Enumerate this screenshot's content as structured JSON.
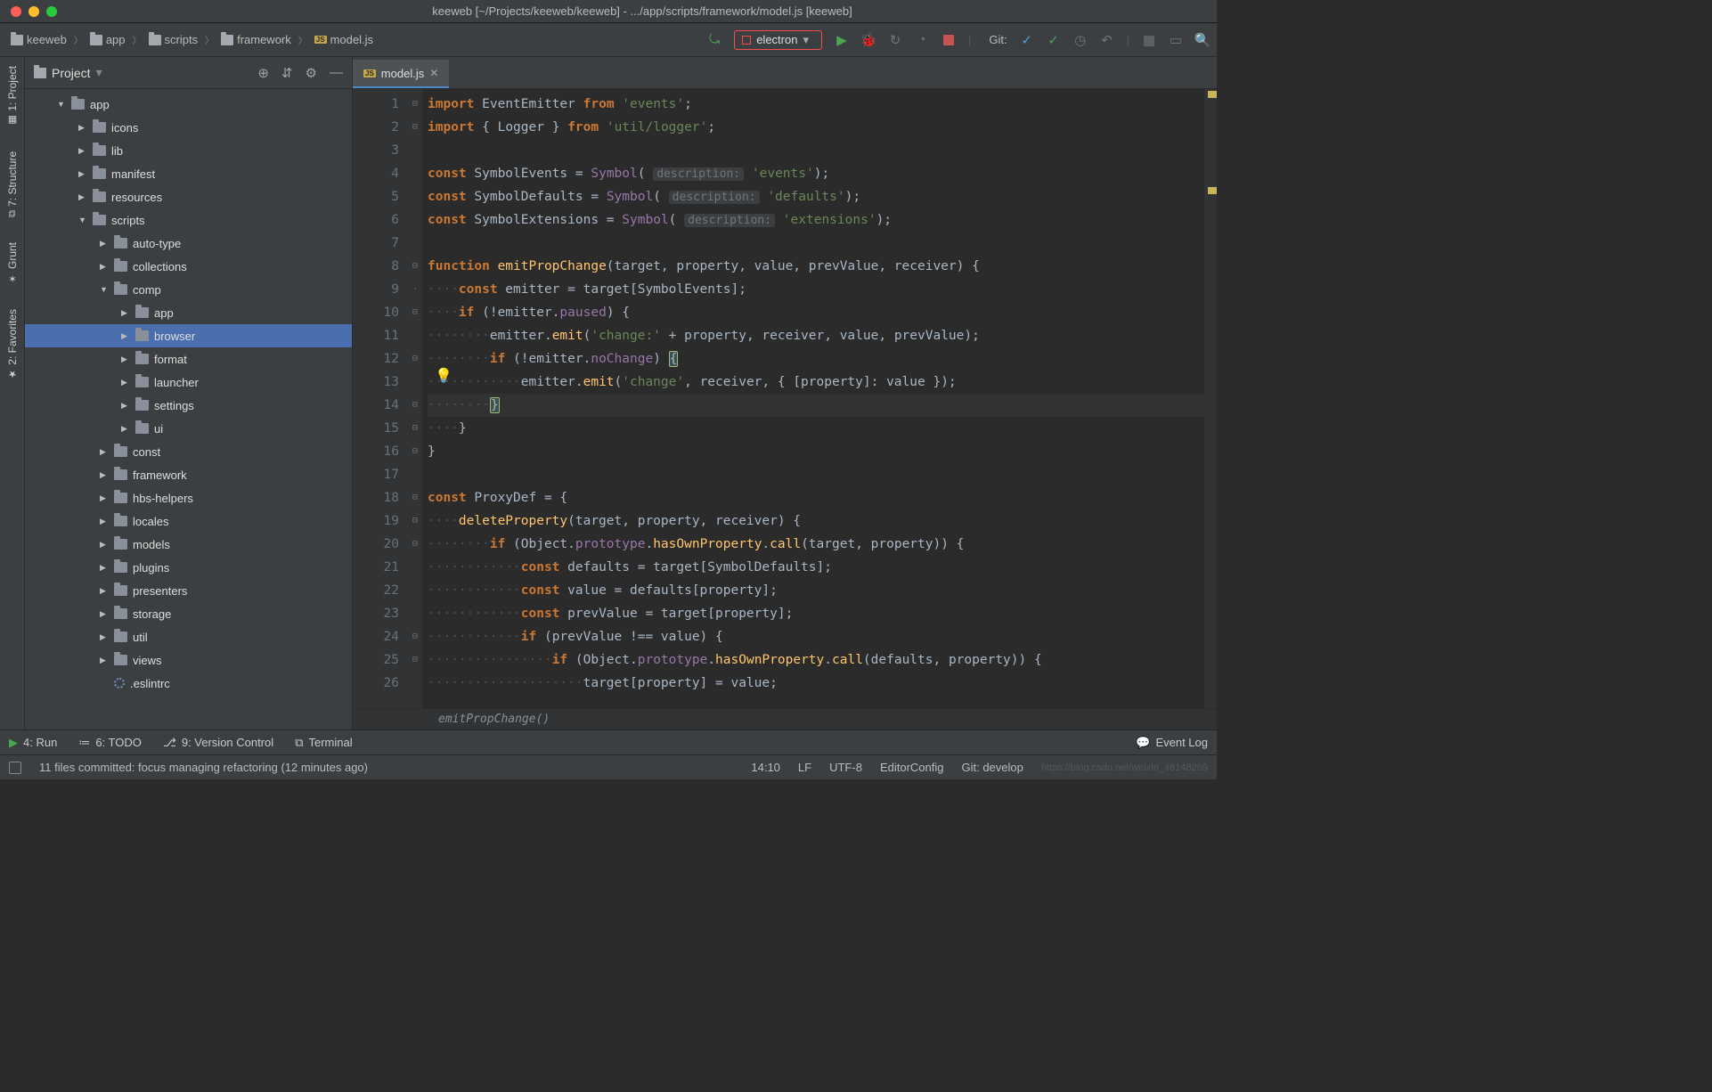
{
  "window": {
    "title": "keeweb [~/Projects/keeweb/keeweb] - .../app/scripts/framework/model.js [keeweb]"
  },
  "breadcrumb": [
    "keeweb",
    "app",
    "scripts",
    "framework",
    "model.js"
  ],
  "run_config": "electron",
  "git_label": "Git:",
  "left_tabs": [
    "1: Project",
    "7: Structure",
    "Grunt",
    "2: Favorites"
  ],
  "tree_header": "Project",
  "tree": [
    {
      "name": "app",
      "depth": 1,
      "caret": "down"
    },
    {
      "name": "icons",
      "depth": 2,
      "caret": "right"
    },
    {
      "name": "lib",
      "depth": 2,
      "caret": "right"
    },
    {
      "name": "manifest",
      "depth": 2,
      "caret": "right"
    },
    {
      "name": "resources",
      "depth": 2,
      "caret": "right"
    },
    {
      "name": "scripts",
      "depth": 2,
      "caret": "down"
    },
    {
      "name": "auto-type",
      "depth": 3,
      "caret": "right"
    },
    {
      "name": "collections",
      "depth": 3,
      "caret": "right"
    },
    {
      "name": "comp",
      "depth": 3,
      "caret": "down"
    },
    {
      "name": "app",
      "depth": 4,
      "caret": "right"
    },
    {
      "name": "browser",
      "depth": 4,
      "caret": "right",
      "sel": true
    },
    {
      "name": "format",
      "depth": 4,
      "caret": "right"
    },
    {
      "name": "launcher",
      "depth": 4,
      "caret": "right"
    },
    {
      "name": "settings",
      "depth": 4,
      "caret": "right"
    },
    {
      "name": "ui",
      "depth": 4,
      "caret": "right"
    },
    {
      "name": "const",
      "depth": 3,
      "caret": "right"
    },
    {
      "name": "framework",
      "depth": 3,
      "caret": "right"
    },
    {
      "name": "hbs-helpers",
      "depth": 3,
      "caret": "right"
    },
    {
      "name": "locales",
      "depth": 3,
      "caret": "right"
    },
    {
      "name": "models",
      "depth": 3,
      "caret": "right"
    },
    {
      "name": "plugins",
      "depth": 3,
      "caret": "right"
    },
    {
      "name": "presenters",
      "depth": 3,
      "caret": "right"
    },
    {
      "name": "storage",
      "depth": 3,
      "caret": "right"
    },
    {
      "name": "util",
      "depth": 3,
      "caret": "right"
    },
    {
      "name": "views",
      "depth": 3,
      "caret": "right"
    },
    {
      "name": ".eslintrc",
      "depth": 3,
      "caret": "none",
      "icon": "ring"
    }
  ],
  "editor_tab": "model.js",
  "code_lines": [
    {
      "n": 1,
      "html": "<span class='kw'>import</span> <span class='cls'>EventEmitter</span> <span class='kw'>from</span> <span class='str'>'events'</span>;"
    },
    {
      "n": 2,
      "html": "<span class='kw'>import</span> { <span class='cls'>Logger</span> } <span class='kw'>from</span> <span class='str'>'util/logger'</span>;"
    },
    {
      "n": 3,
      "html": ""
    },
    {
      "n": 4,
      "html": "<span class='kw'>const</span> <span class='id'>SymbolEvents</span> = <span class='builtin'>Symbol</span>( <span class='hint'>description:</span> <span class='str'>'events'</span>);"
    },
    {
      "n": 5,
      "html": "<span class='kw'>const</span> <span class='id'>SymbolDefaults</span> = <span class='builtin'>Symbol</span>( <span class='hint'>description:</span> <span class='str'>'defaults'</span>);"
    },
    {
      "n": 6,
      "html": "<span class='kw'>const</span> <span class='id'>SymbolExtensions</span> = <span class='builtin'>Symbol</span>( <span class='hint'>description:</span> <span class='str'>'extensions'</span>);"
    },
    {
      "n": 7,
      "html": ""
    },
    {
      "n": 8,
      "html": "<span class='kw'>function</span> <span class='fn'>emitPropChange</span>(target, property, value, prevValue, receiver) {"
    },
    {
      "n": 9,
      "html": "<span class='dots'>····</span><span class='kw'>const</span> emitter = target[SymbolEvents];"
    },
    {
      "n": 10,
      "html": "<span class='dots'>····</span><span class='kw'>if</span> (!emitter.<span class='prop'>paused</span>) {"
    },
    {
      "n": 11,
      "html": "<span class='dots'>········</span>emitter.<span class='mtd'>emit</span>(<span class='str'>'change:'</span> + property, receiver, value, prevValue);"
    },
    {
      "n": 12,
      "html": "<span class='dots'>········</span><span class='kw'>if</span> (!emitter.<span class='prop'>noChange</span>) <span class='bracehl'>{</span>"
    },
    {
      "n": 13,
      "html": "<span class='dots'>············</span>emitter.<span class='mtd'>emit</span>(<span class='str'>'change'</span>, receiver, { [property]: value });"
    },
    {
      "n": 14,
      "html": "<span class='dots'>········</span><span class='bracehl'>}</span>",
      "cur": true
    },
    {
      "n": 15,
      "html": "<span class='dots'>····</span>}"
    },
    {
      "n": 16,
      "html": "}"
    },
    {
      "n": 17,
      "html": ""
    },
    {
      "n": 18,
      "html": "<span class='kw'>const</span> ProxyDef = {"
    },
    {
      "n": 19,
      "html": "<span class='dots'>····</span><span class='fn'>deleteProperty</span>(target, property, receiver) {"
    },
    {
      "n": 20,
      "html": "<span class='dots'>········</span><span class='kw'>if</span> (Object.<span class='prop'>prototype</span>.<span class='mtd'>hasOwnProperty</span>.<span class='mtd'>call</span>(target, property)) {"
    },
    {
      "n": 21,
      "html": "<span class='dots'>············</span><span class='kw'>const</span> defaults = target[SymbolDefaults];"
    },
    {
      "n": 22,
      "html": "<span class='dots'>············</span><span class='kw'>const</span> value = defaults[property];"
    },
    {
      "n": 23,
      "html": "<span class='dots'>············</span><span class='kw'>const</span> prevValue = target[property];"
    },
    {
      "n": 24,
      "html": "<span class='dots'>············</span><span class='kw'>if</span> (prevValue !== value) {"
    },
    {
      "n": 25,
      "html": "<span class='dots'>················</span><span class='kw'>if</span> (Object.<span class='prop'>prototype</span>.<span class='mtd'>hasOwnProperty</span>.<span class='mtd'>call</span>(defaults, property)) {"
    },
    {
      "n": 26,
      "html": "<span class='dots'>····················</span>target[property] = value;"
    }
  ],
  "fold_marks": {
    "1": "⊟",
    "2": "⊟",
    "8": "⊟",
    "9": "·",
    "10": "⊟",
    "12": "⊟",
    "14": "⊟",
    "15": "⊟",
    "16": "⊟",
    "18": "⊟",
    "19": "⊟",
    "20": "⊟",
    "24": "⊟",
    "25": "⊟"
  },
  "breadcrumb_fn": "emitPropChange()",
  "bottom_tools": {
    "run": "4: Run",
    "todo": "6: TODO",
    "vcs": "9: Version Control",
    "terminal": "Terminal",
    "eventlog": "Event Log"
  },
  "status": {
    "msg": "11 files committed: focus managing refactoring (12 minutes ago)",
    "pos": "14:10",
    "sep": "LF",
    "enc": "UTF-8",
    "style": "EditorConfig",
    "branch": "Git: develop",
    "watermark": "https://blog.csdn.net/weixin_46148269"
  }
}
